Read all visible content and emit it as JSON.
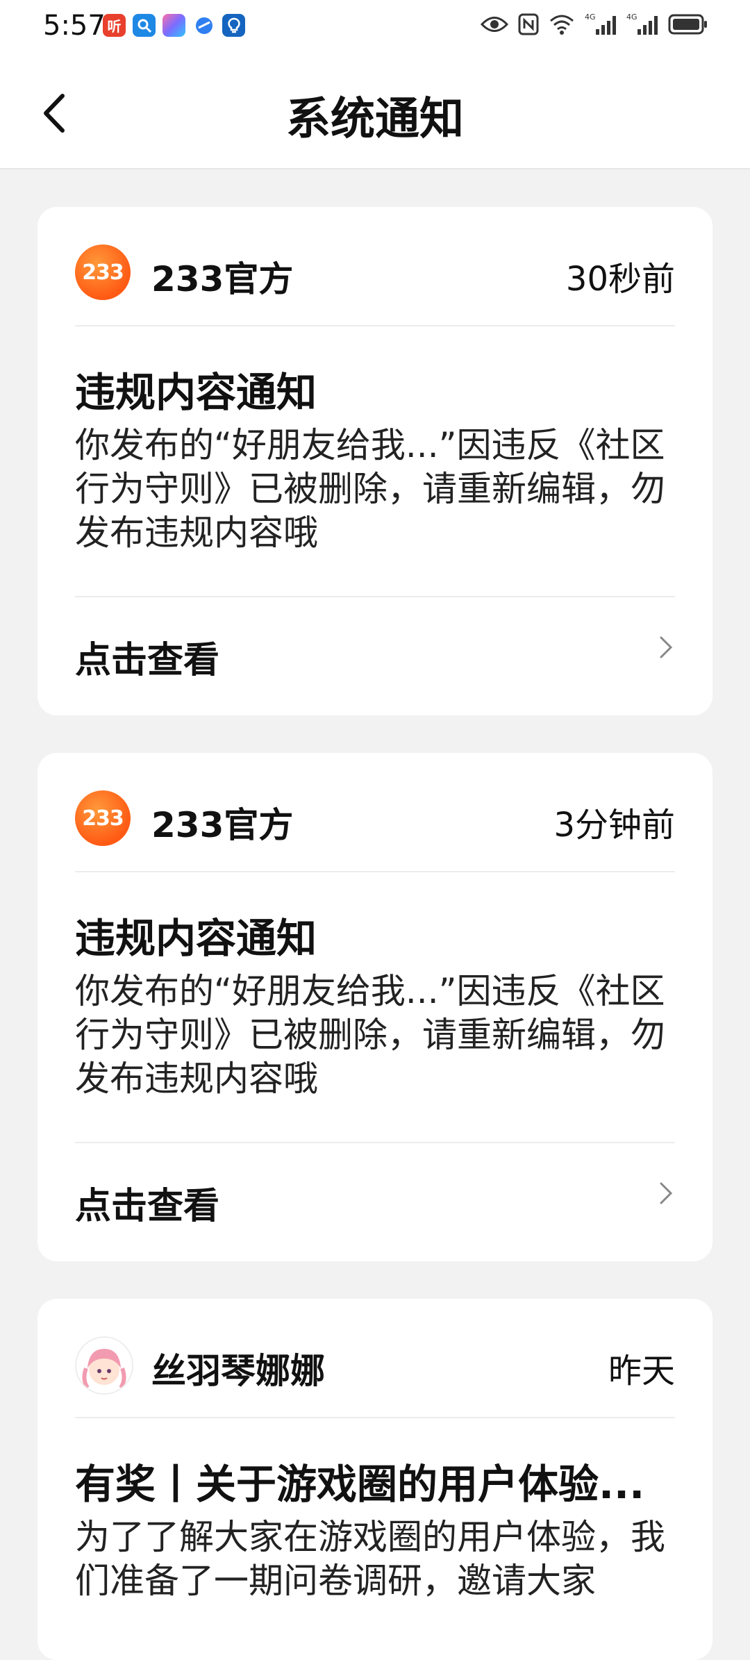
{
  "status_bar": {
    "time": "5:57",
    "app_icons": [
      "ting-app-icon",
      "search-app-icon",
      "gallery-app-icon",
      "browser-app-icon",
      "tips-app-icon"
    ],
    "right_icons": [
      "eye-icon",
      "nfc-icon",
      "wifi-icon",
      "signal-4g-icon",
      "signal-4g-icon",
      "battery-icon"
    ],
    "network_label": "4G"
  },
  "header": {
    "back_icon": "back-arrow-icon",
    "title": "系统通知"
  },
  "notifications": [
    {
      "sender": "233官方",
      "avatar_text": "233",
      "time": "30秒前",
      "title": "违规内容通知",
      "body": "你发布的“好朋友给我...”因违反《社区行为守则》已被删除，请重新编辑，勿发布违规内容哦",
      "action": "点击查看"
    },
    {
      "sender": "233官方",
      "avatar_text": "233",
      "time": "3分钟前",
      "title": "违规内容通知",
      "body": "你发布的“好朋友给我...”因违反《社区行为守则》已被删除，请重新编辑，勿发布违规内容哦",
      "action": "点击查看"
    },
    {
      "sender": "丝羽琴娜娜",
      "time": "昨天",
      "title": "有奖丨关于游戏圈的用户体验...",
      "body": "为了了解大家在游戏圈的用户体验，我们准备了一期问卷调研，邀请大家"
    }
  ],
  "colors": {
    "background": "#f2f2f2",
    "card": "#ffffff",
    "brand_orange": "#ff6a1a",
    "text": "#111111"
  }
}
